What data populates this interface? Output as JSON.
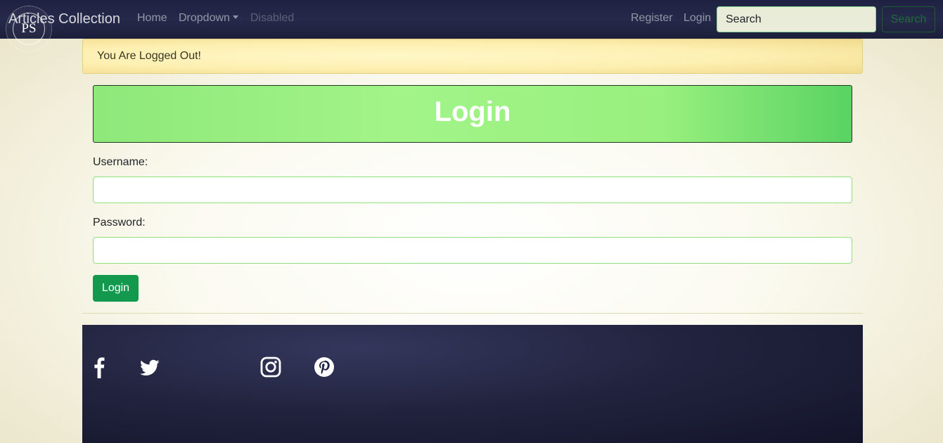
{
  "navbar": {
    "logo_text": "PS",
    "brand": "Articles Collection",
    "links": [
      {
        "label": "Home"
      },
      {
        "label": "Dropdown"
      },
      {
        "label": "Disabled"
      }
    ],
    "right_links": [
      {
        "label": "Register"
      },
      {
        "label": "Login"
      }
    ],
    "search": {
      "placeholder": "Search",
      "button_label": "Search"
    }
  },
  "alert": {
    "text": "You Are Logged Out!"
  },
  "form": {
    "title": "Login",
    "username_label": "Username:",
    "username_value": "",
    "password_label": "Password:",
    "password_value": "",
    "submit_label": "Login"
  },
  "footer": {
    "social_icons": [
      "facebook-icon",
      "twitter-icon",
      "instagram-icon",
      "pinterest-icon"
    ]
  },
  "colors": {
    "navbar_bg": "#1e2140",
    "alert_bg": "#fdefb0",
    "header_bg": "#a2f488",
    "button_bg": "#12994e",
    "footer_bg": "#22243f"
  }
}
